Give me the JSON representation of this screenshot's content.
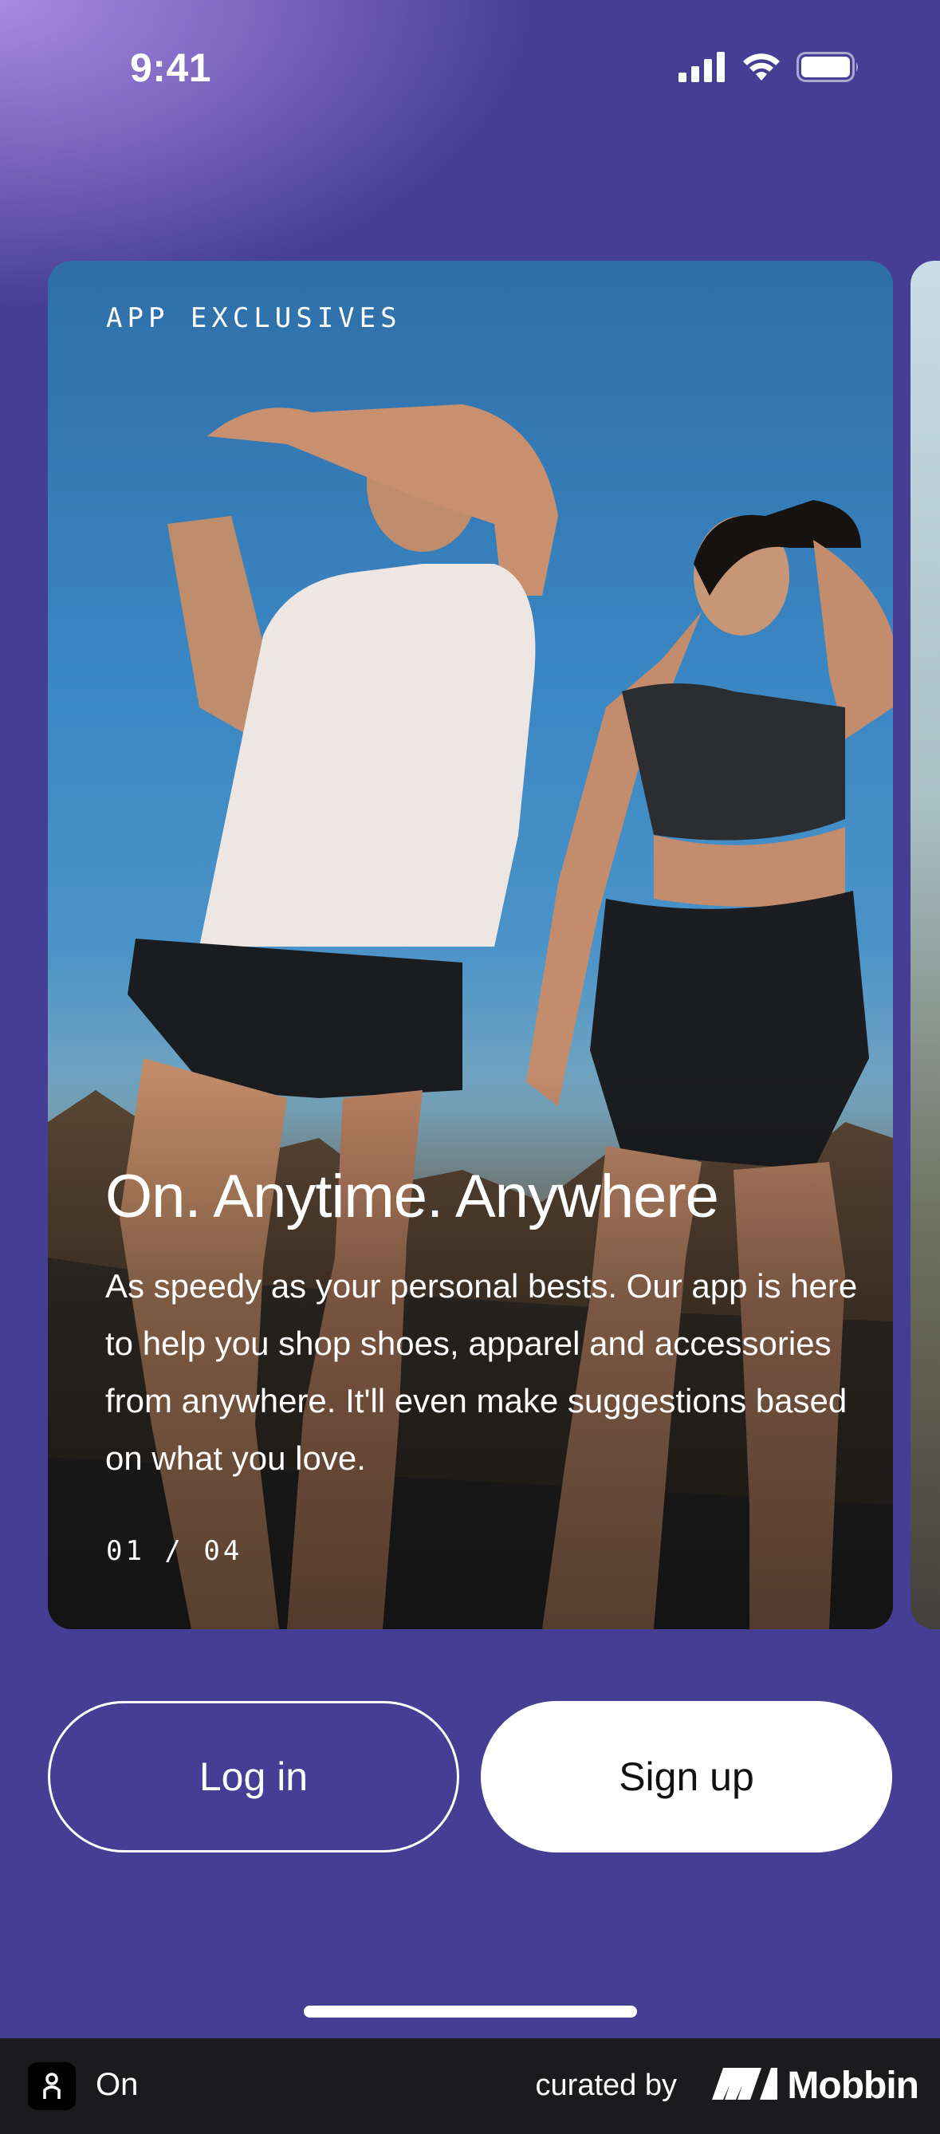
{
  "status_bar": {
    "time": "9:41",
    "icons": [
      "cellular-signal-icon",
      "wifi-icon",
      "battery-icon"
    ]
  },
  "carousel": {
    "card": {
      "eyebrow": "APP EXCLUSIVES",
      "title": "On. Anytime. Anywhere",
      "body": "As speedy as your personal bests. Our app is here to help you shop shoes, apparel and accessories from anywhere. It'll even make suggestions based on what you love.",
      "counter": "01 / 04"
    }
  },
  "actions": {
    "login_label": "Log in",
    "signup_label": "Sign up"
  },
  "footer": {
    "app_name": "On",
    "curated_by": "curated by",
    "brand": "Mobbin"
  },
  "colors": {
    "background": "#463d94",
    "gradient_highlight": "#a98ae6",
    "footer": "#1b1b1d",
    "button_text_dark": "#111111",
    "white": "#ffffff"
  }
}
